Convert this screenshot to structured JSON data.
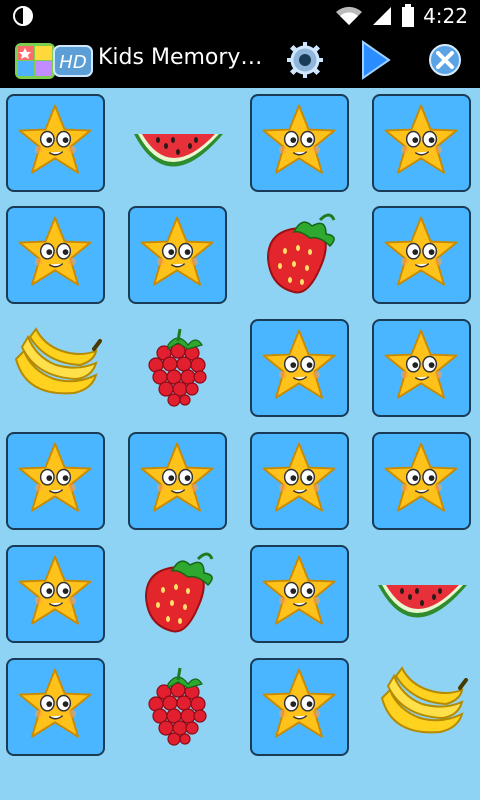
{
  "status_bar": {
    "time": "4:22",
    "icons": [
      "brightness-icon",
      "wifi-icon",
      "signal-icon",
      "battery-icon"
    ]
  },
  "action_bar": {
    "title": "Kids Memory…",
    "badge_text": "HD",
    "actions": [
      "settings-icon",
      "play-icon",
      "close-icon"
    ]
  },
  "board": {
    "columns": 4,
    "rows": 6,
    "cells": [
      {
        "state": "hidden"
      },
      {
        "state": "revealed",
        "fruit": "watermelon"
      },
      {
        "state": "hidden"
      },
      {
        "state": "hidden"
      },
      {
        "state": "hidden"
      },
      {
        "state": "hidden"
      },
      {
        "state": "revealed",
        "fruit": "strawberry"
      },
      {
        "state": "hidden"
      },
      {
        "state": "revealed",
        "fruit": "banana"
      },
      {
        "state": "revealed",
        "fruit": "raspberry"
      },
      {
        "state": "hidden"
      },
      {
        "state": "hidden"
      },
      {
        "state": "hidden"
      },
      {
        "state": "hidden"
      },
      {
        "state": "hidden"
      },
      {
        "state": "hidden"
      },
      {
        "state": "hidden"
      },
      {
        "state": "revealed",
        "fruit": "strawberry"
      },
      {
        "state": "hidden"
      },
      {
        "state": "revealed",
        "fruit": "watermelon"
      },
      {
        "state": "hidden"
      },
      {
        "state": "revealed",
        "fruit": "raspberry"
      },
      {
        "state": "hidden"
      },
      {
        "state": "revealed",
        "fruit": "banana"
      }
    ]
  }
}
